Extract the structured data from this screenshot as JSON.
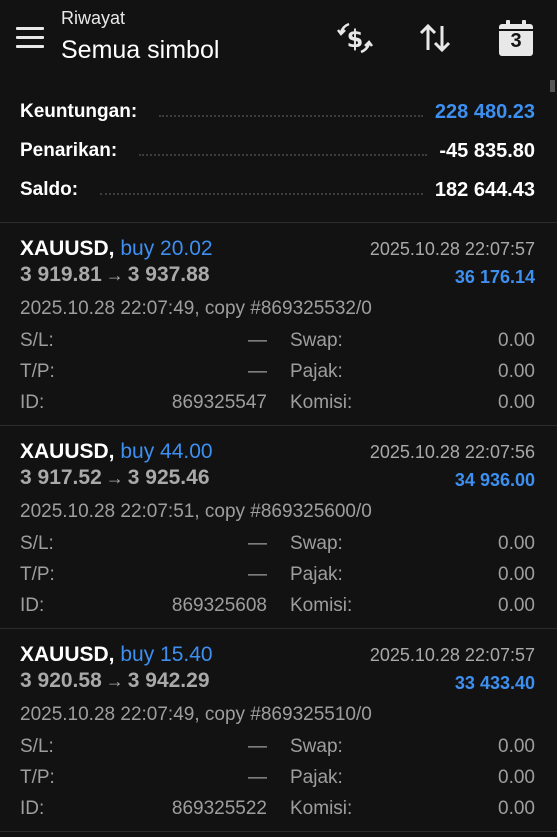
{
  "header": {
    "subtitle": "Riwayat",
    "title": "Semua simbol",
    "calendar_day": "3"
  },
  "summary": {
    "profit_label": "Keuntungan:",
    "profit_value": "228 480.23",
    "withdrawal_label": "Penarikan:",
    "withdrawal_value": "-45 835.80",
    "balance_label": "Saldo:",
    "balance_value": "182 644.43"
  },
  "labels": {
    "sl": "S/L:",
    "tp": "T/P:",
    "id": "ID:",
    "swap": "Swap:",
    "tax": "Pajak:",
    "commission": "Komisi:",
    "arrow": "→"
  },
  "trades": [
    {
      "symbol": "XAUUSD,",
      "side": "buy 20.02",
      "time": "2025.10.28 22:07:57",
      "open_price": "3 919.81",
      "close_price": "3 937.88",
      "profit": "36 176.14",
      "comment": "2025.10.28 22:07:49, copy #869325532/0",
      "sl": "—",
      "tp": "—",
      "id": "869325547",
      "swap": "0.00",
      "tax": "0.00",
      "commission": "0.00"
    },
    {
      "symbol": "XAUUSD,",
      "side": "buy 44.00",
      "time": "2025.10.28 22:07:56",
      "open_price": "3 917.52",
      "close_price": "3 925.46",
      "profit": "34 936.00",
      "comment": "2025.10.28 22:07:51, copy #869325600/0",
      "sl": "—",
      "tp": "—",
      "id": "869325608",
      "swap": "0.00",
      "tax": "0.00",
      "commission": "0.00"
    },
    {
      "symbol": "XAUUSD,",
      "side": "buy 15.40",
      "time": "2025.10.28 22:07:57",
      "open_price": "3 920.58",
      "close_price": "3 942.29",
      "profit": "33 433.40",
      "comment": "2025.10.28 22:07:49, copy #869325510/0",
      "sl": "—",
      "tp": "—",
      "id": "869325522",
      "swap": "0.00",
      "tax": "0.00",
      "commission": "0.00"
    }
  ],
  "colors": {
    "background": "#121212",
    "accent_blue": "#3d8ff0",
    "text_muted": "#9e9e9e"
  },
  "icons": [
    "menu-icon",
    "dollar-exchange-icon",
    "sort-icon",
    "calendar-icon"
  ]
}
